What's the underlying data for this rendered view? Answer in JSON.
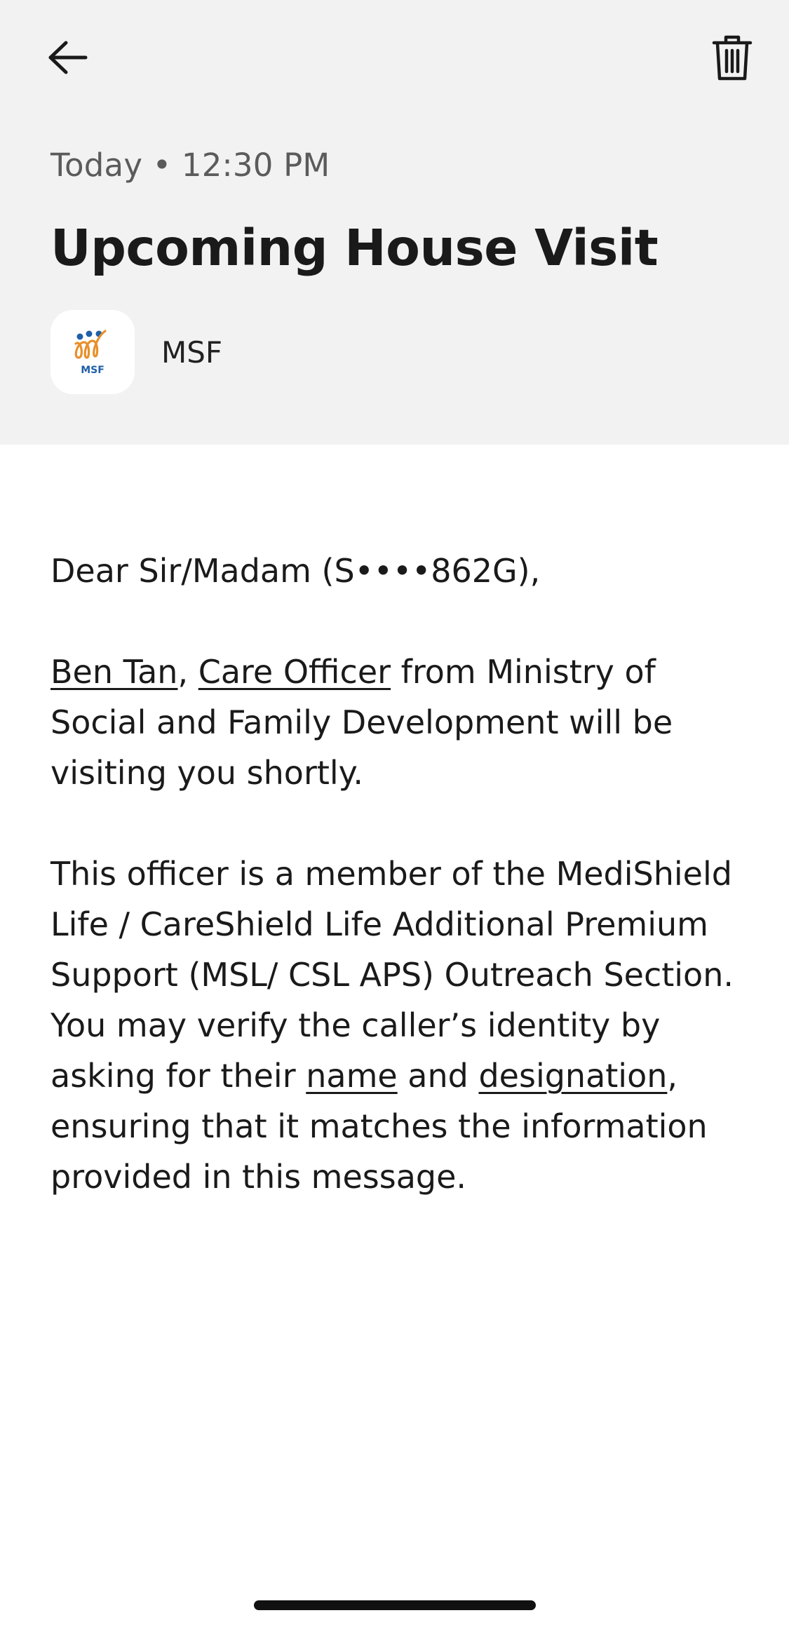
{
  "header": {
    "timestamp": "Today • 12:30 PM",
    "title": "Upcoming House Visit",
    "sender": {
      "name": "MSF",
      "logo_text": "MSF"
    },
    "icons": {
      "back": "arrow-left-icon",
      "delete": "trash-icon"
    }
  },
  "message": {
    "greeting": "Dear Sir/Madam (S••••862G),",
    "officer_name": "Ben Tan",
    "sep": ", ",
    "officer_role": "Care Officer",
    "intro_rest": " from Ministry of Social and Family Development will be visiting you shortly.",
    "para2_start": "This officer is a member of the MediShield Life / CareShield Life Additional Premium Support (MSL/ CSL APS) Outreach Section. You may verify the caller’s identity by asking for their ",
    "link_name": "name",
    "and": " and ",
    "link_designation": "designation",
    "para2_end": ", ensuring that it matches the information provided in this message."
  },
  "colors": {
    "header_bg": "#f2f2f2",
    "logo_orange": "#e8902a",
    "logo_blue": "#1f5fa8"
  }
}
